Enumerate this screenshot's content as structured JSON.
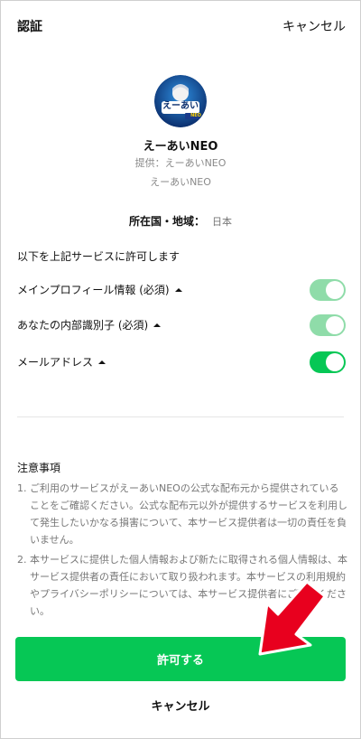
{
  "header": {
    "title": "認証",
    "cancel_label": "キャンセル"
  },
  "app": {
    "icon_text": "えーあい",
    "icon_subtext": "NEO",
    "name": "えーあいNEO",
    "provider": "提供：えーあいNEO",
    "provider_name": "えーあいNEO"
  },
  "region": {
    "label": "所在国・地域：",
    "value": "日本"
  },
  "permissions": {
    "heading": "以下を上記サービスに許可します",
    "items": [
      {
        "label": "メインプロフィール情報 (必須)",
        "state": "on",
        "required": true
      },
      {
        "label": "あなたの内部識別子 (必須)",
        "state": "on",
        "required": true
      },
      {
        "label": "メールアドレス",
        "state": "on",
        "required": false
      }
    ]
  },
  "notice": {
    "title": "注意事項",
    "items": [
      {
        "num": "1.",
        "text": "ご利用のサービスがえーあいNEOの公式な配布元から提供されていることをご確認ください。公式な配布元以外が提供するサービスを利用して発生したいかなる損害について、本サービス提供者は一切の責任を負いません。"
      },
      {
        "num": "2.",
        "text": "本サービスに提供した個人情報および新たに取得される個人情報は、本サービス提供者の責任において取り扱われます。本サービスの利用規約やプライバシーポリシーについては、本サービス提供者にご確認ください。"
      }
    ]
  },
  "actions": {
    "allow_label": "許可する",
    "cancel_label": "キャンセル"
  },
  "colors": {
    "accent": "#06c755",
    "accent_disabled": "#8fdca9",
    "arrow": "#e8001e"
  },
  "icons": {
    "expand": "chevron-up-icon",
    "annotation": "red-arrow-icon"
  }
}
